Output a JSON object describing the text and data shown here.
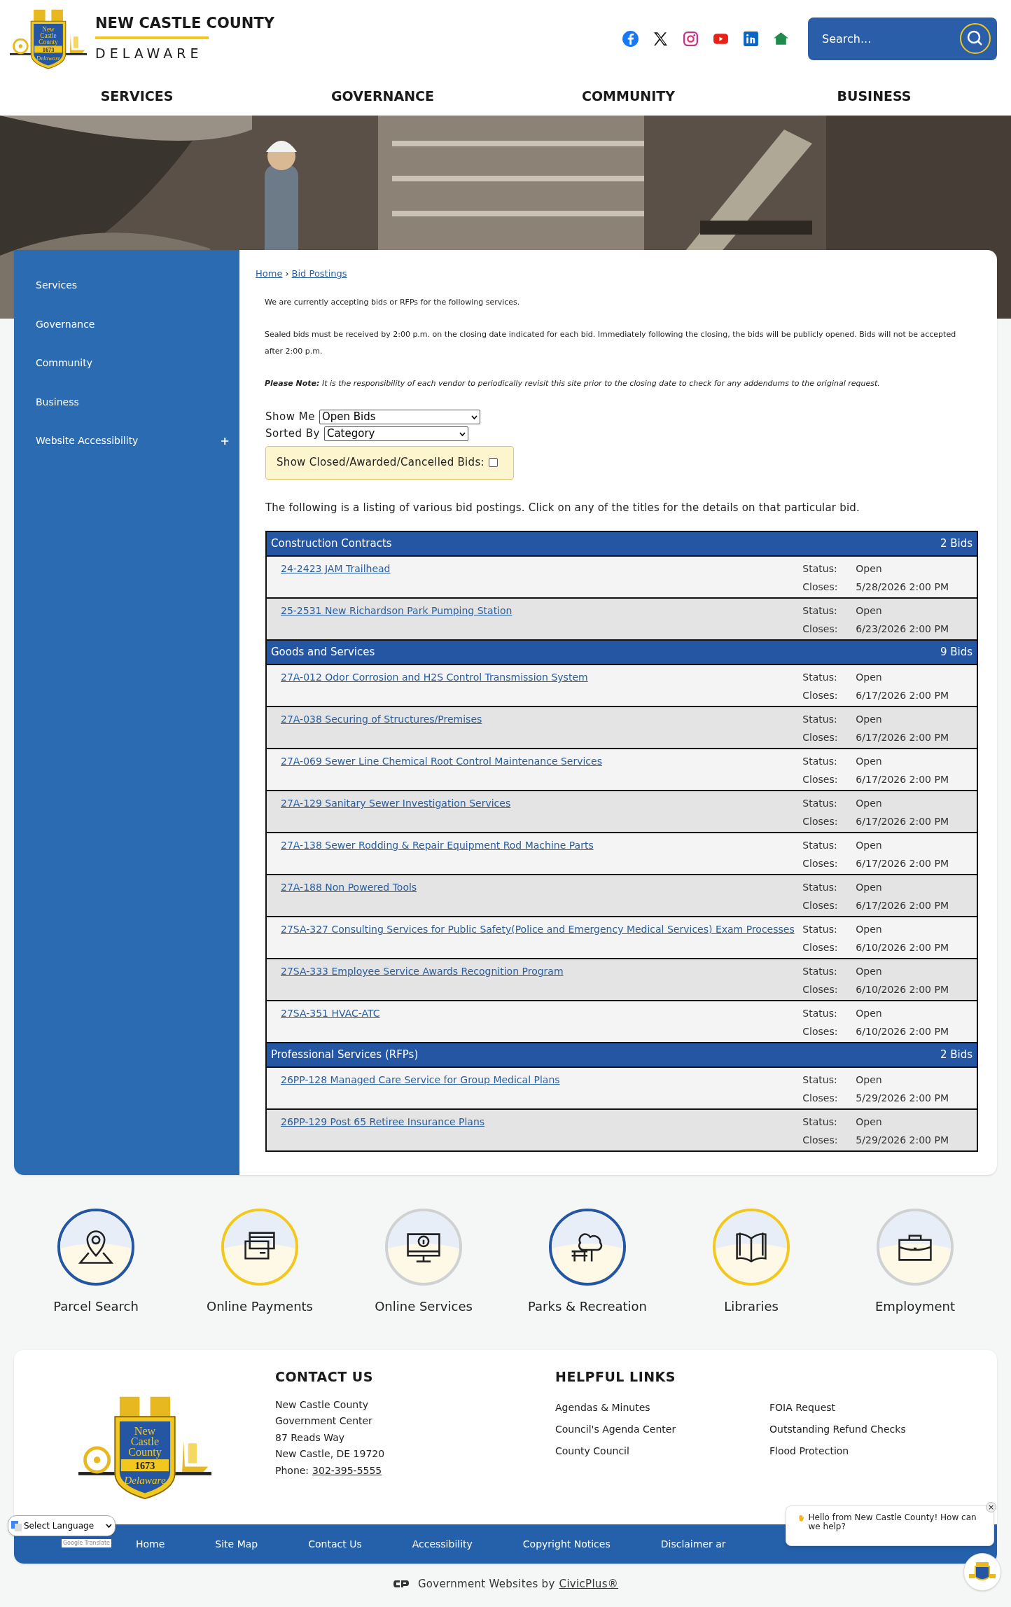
{
  "header": {
    "site_name": "NEW CASTLE COUNTY",
    "site_subtitle": "DELAWARE",
    "seal": {
      "lines": [
        "New",
        "Castle",
        "County"
      ],
      "year": "1673",
      "motto": "Delaware"
    },
    "search": {
      "placeholder": "Search..."
    }
  },
  "nav": [
    "SERVICES",
    "GOVERNANCE",
    "COMMUNITY",
    "BUSINESS"
  ],
  "hero": {
    "kind": "picture"
  },
  "sidebar": {
    "items": [
      {
        "label": "Services",
        "expandable": false
      },
      {
        "label": "Governance",
        "expandable": false
      },
      {
        "label": "Community",
        "expandable": false
      },
      {
        "label": "Business",
        "expandable": false
      },
      {
        "label": "Website Accessibility",
        "expandable": true,
        "toggle": "+"
      }
    ]
  },
  "breadcrumb": {
    "items": [
      "Home",
      "Bid Postings"
    ],
    "separator": "›"
  },
  "intro": [
    "We are currently accepting bids or RFPs for the following services.",
    "Sealed bids must be received by 2:00 p.m. on the closing date indicated for each bid. Immediately following the closing, the bids will be publicly opened. Bids will not be accepted after 2:00 p.m."
  ],
  "note": "**Please Note:** It is the responsibility of each vendor to periodically revisit this site prior to the closing date to check for any addendums to the original request.",
  "filters": {
    "show_me": {
      "label": "Show Me",
      "value": "Open Bids"
    },
    "sorted_by": {
      "label": "Sorted By",
      "value": "Category"
    },
    "show_closed": {
      "label": "Show Closed/Awarded/Cancelled Bids:",
      "checked": false
    }
  },
  "listing_intro": "The following is a listing of various bid postings. Click on any of the titles for the details on that particular bid.",
  "categories": [
    {
      "name": "Construction Contracts",
      "count": "2 Bids",
      "bids": [
        {
          "title": "24-2423 JAM Trailhead",
          "status_label": "Status:",
          "status": "Open",
          "closes_label": "Closes:",
          "closes": "5/28/2026 2:00 PM"
        },
        {
          "title": "25-2531 New Richardson Park Pumping Station",
          "status_label": "Status:",
          "status": "Open",
          "closes_label": "Closes:",
          "closes": "6/23/2026 2:00 PM"
        }
      ]
    },
    {
      "name": "Goods and Services",
      "count": "9 Bids",
      "bids": [
        {
          "title": "27A-012 Odor Corrosion and H2S Control Transmission System",
          "status_label": "Status:",
          "status": "Open",
          "closes_label": "Closes:",
          "closes": "6/17/2026 2:00 PM"
        },
        {
          "title": "27A-038 Securing of Structures/Premises",
          "status_label": "Status:",
          "status": "Open",
          "closes_label": "Closes:",
          "closes": "6/17/2026 2:00 PM"
        },
        {
          "title": "27A-069 Sewer Line Chemical Root Control Maintenance Services",
          "status_label": "Status:",
          "status": "Open",
          "closes_label": "Closes:",
          "closes": "6/17/2026 2:00 PM"
        },
        {
          "title": "27A-129 Sanitary Sewer Investigation Services",
          "status_label": "Status:",
          "status": "Open",
          "closes_label": "Closes:",
          "closes": "6/17/2026 2:00 PM"
        },
        {
          "title": "27A-138 Sewer Rodding & Repair Equipment Rod Machine Parts",
          "status_label": "Status:",
          "status": "Open",
          "closes_label": "Closes:",
          "closes": "6/17/2026 2:00 PM"
        },
        {
          "title": "27A-188 Non Powered Tools",
          "status_label": "Status:",
          "status": "Open",
          "closes_label": "Closes:",
          "closes": "6/17/2026 2:00 PM"
        },
        {
          "title": "27SA-327 Consulting Services for Public Safety(Police and Emergency Medical Services) Exam Processes",
          "status_label": "Status:",
          "status": "Open",
          "closes_label": "Closes:",
          "closes": "6/10/2026 2:00 PM"
        },
        {
          "title": "27SA-333 Employee Service Awards Recognition Program",
          "status_label": "Status:",
          "status": "Open",
          "closes_label": "Closes:",
          "closes": "6/10/2026 2:00 PM"
        },
        {
          "title": "27SA-351 HVAC-ATC",
          "status_label": "Status:",
          "status": "Open",
          "closes_label": "Closes:",
          "closes": "6/10/2026 2:00 PM"
        }
      ]
    },
    {
      "name": "Professional Services (RFPs)",
      "count": "2 Bids",
      "bids": [
        {
          "title": "26PP-128 Managed Care Service for Group Medical Plans",
          "status_label": "Status:",
          "status": "Open",
          "closes_label": "Closes:",
          "closes": "5/29/2026 2:00 PM"
        },
        {
          "title": "26PP-129 Post 65 Retiree Insurance Plans",
          "status_label": "Status:",
          "status": "Open",
          "closes_label": "Closes:",
          "closes": "5/29/2026 2:00 PM"
        }
      ]
    }
  ],
  "quick_links": [
    {
      "label": "Parcel Search",
      "kind": "pin",
      "color": "#2456a4"
    },
    {
      "label": "Online Payments",
      "kind": "cards",
      "color": "#f2c81e"
    },
    {
      "label": "Online Services",
      "kind": "monitor",
      "color": "#cfd1d2"
    },
    {
      "label": "Parks & Recreation",
      "kind": "park",
      "color": "#2456a4"
    },
    {
      "label": "Libraries",
      "kind": "book",
      "color": "#f2c81e"
    },
    {
      "label": "Employment",
      "kind": "briefcase",
      "color": "#cfd1d2"
    }
  ],
  "footer": {
    "seal": {
      "lines": [
        "New",
        "Castle",
        "County"
      ],
      "year": "1673",
      "motto": "Delaware"
    },
    "contact": {
      "heading": "CONTACT US",
      "lines": [
        "New Castle County",
        "Government Center",
        "87 Reads Way",
        "New Castle, DE 19720"
      ],
      "phone_label": "Phone:",
      "phone": "302-395-5555"
    },
    "helpful_links": {
      "heading": "HELPFUL LINKS",
      "links": [
        "Agendas & Minutes",
        "FOIA Request",
        "Council's Agenda Center",
        "Outstanding Refund Checks",
        "County Council",
        "Flood Protection"
      ]
    },
    "bottom_links": [
      "Home",
      "Site Map",
      "Contact Us",
      "Accessibility",
      "Copyright Notices",
      "Disclaimer ar"
    ],
    "credit": {
      "text": "Government Websites by",
      "link": "CivicPlus®"
    }
  },
  "language": {
    "value": "Select Language",
    "powered_by": "Google Translate"
  },
  "chat": {
    "message": "Hello from New Castle County! How can we help?",
    "close": "×"
  }
}
